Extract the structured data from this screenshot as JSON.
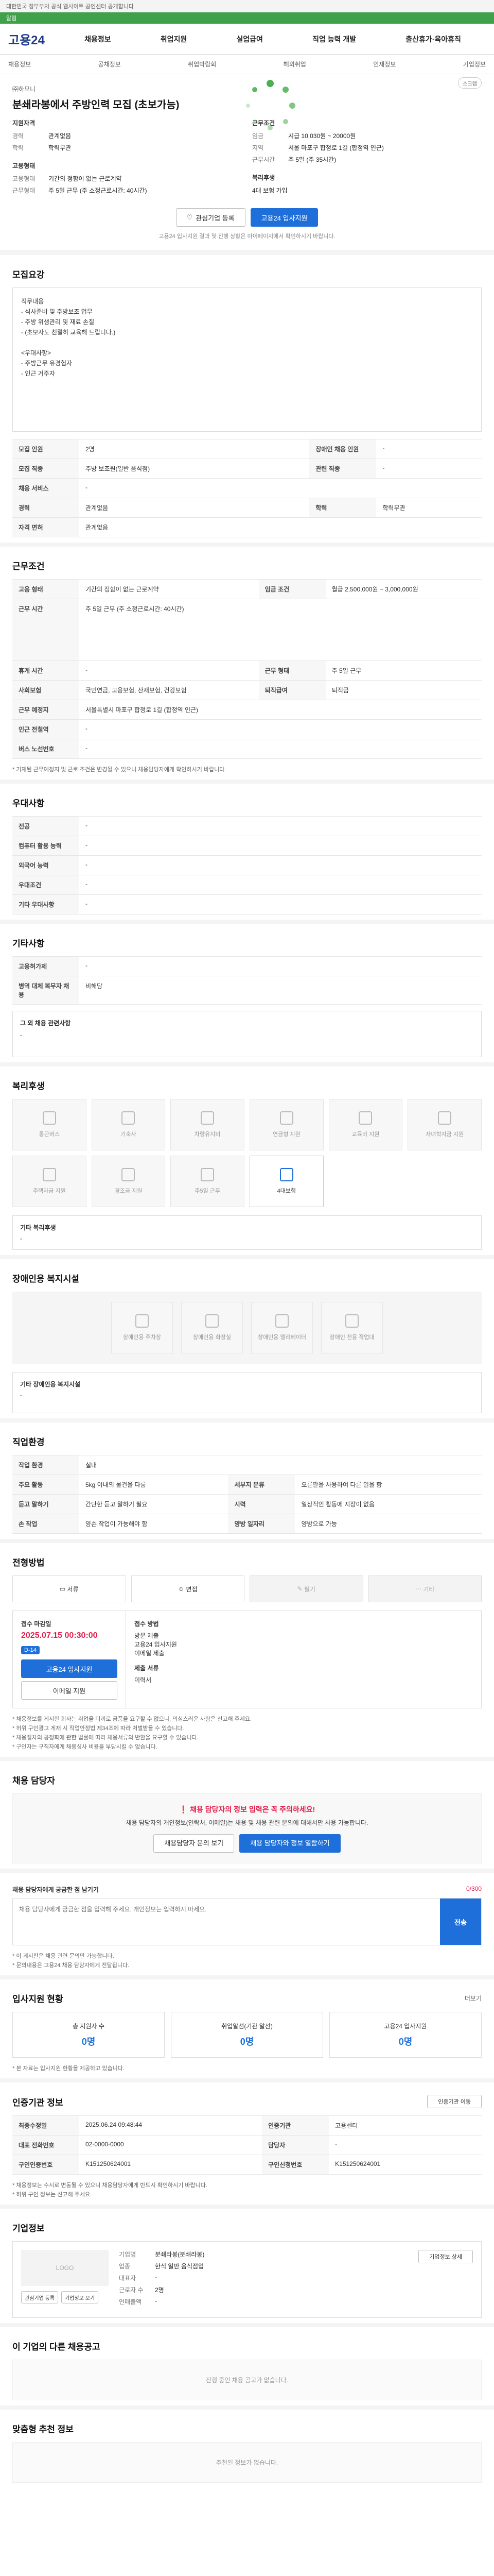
{
  "topbar": {
    "text": "대한민국 정부부처 공식 웹사이트 공인센터 공개합니다"
  },
  "greenbar": {
    "text": "알림"
  },
  "header": {
    "logo": "고용24",
    "gnb": [
      "채용정보",
      "취업지원",
      "실업급여",
      "직업 능력 개발",
      "출산휴가·육아휴직"
    ]
  },
  "subnav": [
    "채용정보",
    "공채정보",
    "취업박람회",
    "해외취업",
    "인재정보",
    "기업정보"
  ],
  "job": {
    "company": "㈜하모니",
    "title": "분쇄라봉에서 주방인력 모집 (초보가능)",
    "scrap": "스크랩",
    "qualification_title": "지원자격",
    "qualification": [
      {
        "k": "경력",
        "v": "관계없음"
      },
      {
        "k": "학력",
        "v": "학력무관"
      }
    ],
    "conditions_title": "근무조건",
    "conditions": [
      {
        "k": "임금",
        "v": "시급 10,030원 ~ 20000원"
      },
      {
        "k": "지역",
        "v": "서울 마포구 합정로 1길 (합정역 인근)"
      },
      {
        "k": "근무시간",
        "v": "주 5일 (주 35시간)"
      }
    ],
    "employment_title": "고용형태",
    "employment": [
      {
        "k": "고용형태",
        "v": "기간의 정함이 없는 근로계약"
      },
      {
        "k": "근무형태",
        "v": "주 5일 근무 (주 소정근로시간: 40시간)"
      }
    ],
    "welfare_title": "복리후생",
    "welfare": [
      {
        "k": "",
        "v": "4대 보험 가입"
      }
    ],
    "buttons": {
      "interest": "관심기업 등록",
      "apply": "고용24 입사지원"
    },
    "note": "고용24 입사지원 결과 및 진행 상황은 마이페이지에서 확인하시기 바랍니다."
  },
  "recruit": {
    "title": "모집요강",
    "body": "직무내용\n- 식사준비 및 주방보조 업무\n- 주방 위생관리 및 재료 손질\n- (초보자도 친절히 교육해 드립니다.)\n\n<우대사항>\n- 주방근무 유경험자\n- 인근 거주자",
    "table": [
      [
        "모집 인원",
        "2명",
        "장애인 채용 인원",
        "-"
      ],
      [
        "모집 직종",
        "주방 보조원(일반 음식점)",
        "관련 직종",
        "-"
      ],
      [
        "채용 서비스",
        "-",
        "",
        ""
      ],
      [
        "경력",
        "관계없음",
        "학력",
        "학력무관"
      ],
      [
        "자격 면허",
        "관계없음",
        "",
        ""
      ]
    ]
  },
  "work": {
    "title": "근무조건",
    "table": [
      [
        "고용 형태",
        "기간의 정함이 없는 근로계약",
        "임금 조건",
        "월급 2,500,000원 ~ 3,000,000원"
      ],
      [
        "근무 시간",
        "주 5일 근무 (주 소정근로시간: 40시간)",
        "",
        ""
      ],
      [
        "휴게 시간",
        "-",
        "근무 형태",
        "주 5일 근무"
      ],
      [
        "사회보험",
        "국민연금, 고용보험, 산재보험, 건강보험",
        "퇴직급여",
        "퇴직금"
      ],
      [
        "근무 예정지",
        "서울특별시 마포구 합정로 1길 (합정역 인근)",
        "",
        ""
      ],
      [
        "인근 전철역",
        "-",
        "",
        ""
      ],
      [
        "버스 노선번호",
        "-",
        "",
        ""
      ]
    ],
    "note": "* 기재된 근무예정지 및 근로 조건은 변경될 수 있으니 채용담당자에게 확인하시기 바랍니다."
  },
  "preference": {
    "title": "우대사항",
    "table": [
      [
        "전공",
        "-"
      ],
      [
        "컴퓨터 활용 능력",
        "-"
      ],
      [
        "외국어 능력",
        "-"
      ],
      [
        "우대조건",
        "-"
      ],
      [
        "기타 우대사항",
        "-"
      ]
    ]
  },
  "etc": {
    "title": "기타사항",
    "table": [
      [
        "고용허가제",
        "-"
      ],
      [
        "병역 대체 복무자 채용",
        "비해당"
      ]
    ],
    "extra_label": "그 외 채용 관련사항",
    "extra_value": "-"
  },
  "welfare": {
    "title": "복리후생",
    "items": [
      {
        "label": "통근버스",
        "on": false
      },
      {
        "label": "기숙사",
        "on": false
      },
      {
        "label": "차량유지비",
        "on": false
      },
      {
        "label": "연금형 지원",
        "on": false
      },
      {
        "label": "교육비 지원",
        "on": false
      },
      {
        "label": "자녀학자금 지원",
        "on": false
      },
      {
        "label": "주택자금 지원",
        "on": false
      },
      {
        "label": "경조금 지원",
        "on": false
      },
      {
        "label": "주5일 근무",
        "on": false
      },
      {
        "label": "4대보험",
        "on": true
      }
    ],
    "other_label": "기타 복리후생",
    "other_value": "-"
  },
  "disabled": {
    "title": "장애인용 복지시설",
    "items": [
      "장애인용 주차장",
      "장애인용 화장실",
      "장애인용 엘리베이터",
      "장애인 전용 작업대"
    ],
    "other_label": "기타 장애인용 복지시설",
    "other_value": "-"
  },
  "company_info": {
    "title": "직업환경",
    "table": [
      [
        "작업 환경",
        "실내",
        "",
        ""
      ],
      [
        "주요 활동",
        "5kg 이내의 물건을 다룸",
        "세부지 분류",
        "오른팔을 사용하여 다른 일을 함"
      ],
      [
        "듣고 말하기",
        "간단한 듣고 말하기 필요",
        "시력",
        "일상적인 활동에 지장이 없음"
      ],
      [
        "손 작업",
        "양손 작업이 가능해야 함",
        "양방 일자리",
        "양방으로 가능"
      ]
    ]
  },
  "apply": {
    "title": "전형방법",
    "methods": [
      {
        "label": "서류",
        "on": true
      },
      {
        "label": "면접",
        "on": true
      },
      {
        "label": "필기",
        "on": false
      },
      {
        "label": "기타",
        "on": false
      }
    ],
    "deadline_label": "접수 마감일",
    "deadline": "2025.07.15 00:30:00",
    "badge": "D-14",
    "apply_btn": "고용24 입사지원",
    "email_btn": "이메일 지원",
    "method_label": "접수 방법",
    "method_values": [
      "방문 제출",
      "고용24 입사지원",
      "이메일 제출"
    ],
    "docs_label": "제출 서류",
    "docs_value": "이력서",
    "notices": [
      "* 채용정보를 게시한 회사는 취업을 미끼로 금품을 요구할 수 없으니, 의심스러운 사항은 신고해 주세요.",
      "* 허위 구인광고 게재 시 직업안정법 제34조에 따라 처벌받을 수 있습니다.",
      "* 채용절차의 공정화에 관한 법률에 따라 채용서류의 반환을 요구할 수 있습니다.",
      "* 구인자는 구직자에게 채용심사 비용을 부담시킬 수 없습니다."
    ]
  },
  "manager": {
    "title": "채용 담당자",
    "warn_title": "채용 담당자의 정보 입력은 꼭 주의하세요!",
    "warn_text": "채용 담당자의 개인정보(연락처, 이메일)는 채용 및 채용 관련 문의에 대해서만 사용 가능합니다.",
    "btn_1": "채용담당자 문의 보기",
    "btn_2": "채용 담당자와 정보 열람하기"
  },
  "qa": {
    "title": "채용 담당자에게 궁금한 점 남기기",
    "placeholder": "채용 담당자에게 궁금한 점을 입력해 주세요. 개인정보는 입력하지 마세요.",
    "counter": "0/300",
    "send": "전송",
    "notes": [
      "* 이 게시판은 채용 관련 문의만 가능합니다.",
      "* 문의내용은 고용24 채용 담당자에게 전달됩니다."
    ]
  },
  "stats": {
    "title": "입사지원 현황",
    "more": "더보기",
    "items": [
      {
        "label": "총 지원자 수",
        "value": "0명"
      },
      {
        "label": "취업알선(기관 알선)",
        "value": "0명"
      },
      {
        "label": "고용24 입사지원",
        "value": "0명"
      }
    ],
    "note": "* 본 자료는 입사지원 현황을 제공하고 있습니다."
  },
  "org": {
    "title": "인증기관 정보",
    "btn": "인증기관 이동",
    "table": [
      [
        "최종수정일",
        "2025.06.24 09:48:44",
        "인증기관",
        "고용센터"
      ],
      [
        "대표 전화번호",
        "02-0000-0000",
        "담당자",
        "-"
      ],
      [
        "구인인증번호",
        "K151250624001",
        "구인신청번호",
        "K151250624001"
      ]
    ],
    "notes": [
      "* 채용정보는 수시로 변동될 수 있으니 채용담당자에게 반드시 확인하시기 바랍니다.",
      "* 허위 구인 정보는 신고해 주세요."
    ]
  },
  "corp": {
    "title": "기업정보",
    "logo_text": "LOGO",
    "name": "분쇄라봉",
    "fields": [
      {
        "k": "기업명",
        "v": "분쇄라봉(분쇄라봉)"
      },
      {
        "k": "업종",
        "v": "한식 일반 음식점업"
      },
      {
        "k": "대표자",
        "v": "-"
      },
      {
        "k": "근로자 수",
        "v": "2명"
      },
      {
        "k": "연매출액",
        "v": "-"
      }
    ],
    "btn_1": "관심기업 등록",
    "btn_2": "기업정보 보기",
    "detail_btn": "기업정보 상세"
  },
  "other": {
    "title": "이 기업의 다른 채용공고",
    "empty": "진행 중인 채용 공고가 없습니다."
  },
  "ad": {
    "title": "맞춤형 추천 정보",
    "empty": "추천된 정보가 없습니다."
  }
}
